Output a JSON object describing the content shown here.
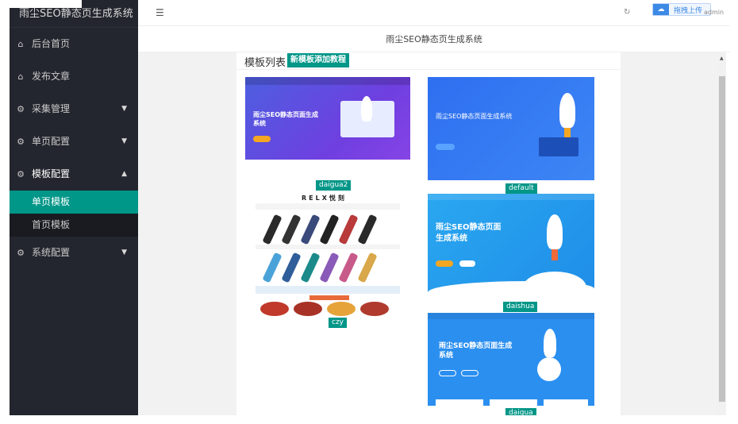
{
  "sidebar": {
    "title": "雨尘SEO静态页生成系统",
    "items": [
      {
        "label": "后台首页",
        "icon": "home-icon",
        "glyph": "⌂",
        "arrow": ""
      },
      {
        "label": "发布文章",
        "icon": "home-icon",
        "glyph": "⌂",
        "arrow": ""
      },
      {
        "label": "采集管理",
        "icon": "gear-icon",
        "glyph": "⚙",
        "arrow": "▼"
      },
      {
        "label": "单页配置",
        "icon": "gear-icon",
        "glyph": "⚙",
        "arrow": "▼"
      },
      {
        "label": "模板配置",
        "icon": "gear-icon",
        "glyph": "⚙",
        "arrow": "▲"
      }
    ],
    "sub_items": [
      {
        "label": "单页模板",
        "active": true
      },
      {
        "label": "首页模板",
        "active": false
      }
    ],
    "last_item": {
      "label": "系统配置",
      "icon": "gear-icon",
      "glyph": "⚙",
      "arrow": "▼"
    }
  },
  "topbar": {
    "menu_glyph": "☰",
    "upload_label": "拖拽上传",
    "user_label": "admin"
  },
  "page": {
    "subtitle": "雨尘SEO静态页生成系统"
  },
  "card": {
    "title": "模板列表",
    "tutorial_button": "新模板添加教程"
  },
  "templates": [
    {
      "name": "daigua2",
      "hero": "雨尘SEO静态页面生成系统"
    },
    {
      "name": "default",
      "hero": "雨尘SEO静态页面生成系统"
    },
    {
      "name": "czy",
      "hero": "RELX悦刻"
    },
    {
      "name": "daishua",
      "hero": "雨尘SEO静态页面生成系统"
    },
    {
      "name": "daigua",
      "hero": "雨尘SEO静态页面生成系统"
    }
  ],
  "colors": {
    "sidebar_bg": "#23262e",
    "accent": "#009688",
    "upload_blue": "#3d89e6"
  }
}
